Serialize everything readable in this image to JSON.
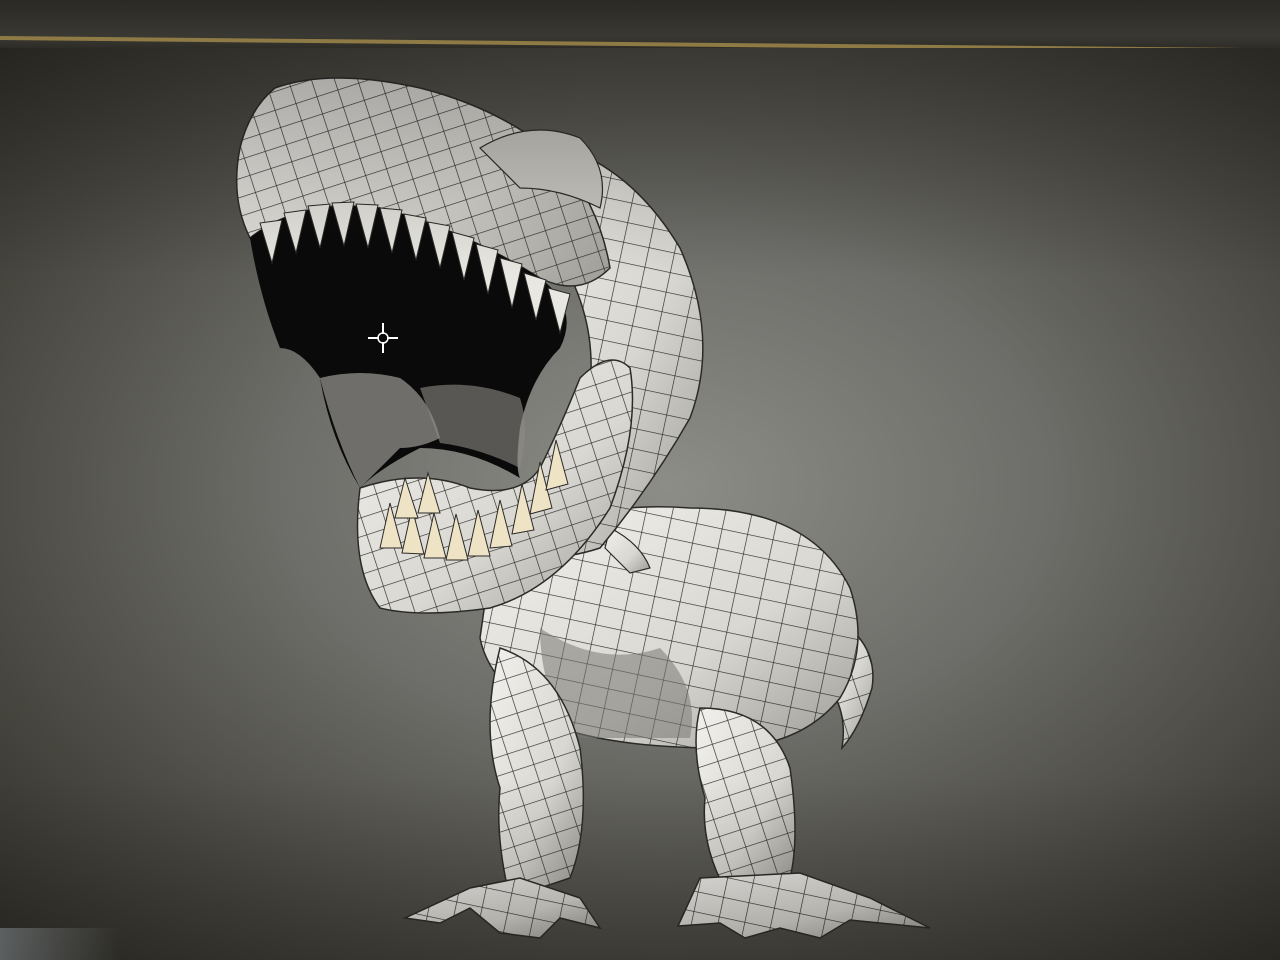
{
  "viewport": {
    "background_color": "#6d6d69",
    "mesh_color": "#e6e4df",
    "wire_color": "#2a2a28",
    "teeth_color": "#efe3c6",
    "mouth_color": "#0a0a0a"
  },
  "model": {
    "icon": "trex-wireframe-icon"
  },
  "cursor": {
    "icon": "crosshair-cursor-icon"
  }
}
